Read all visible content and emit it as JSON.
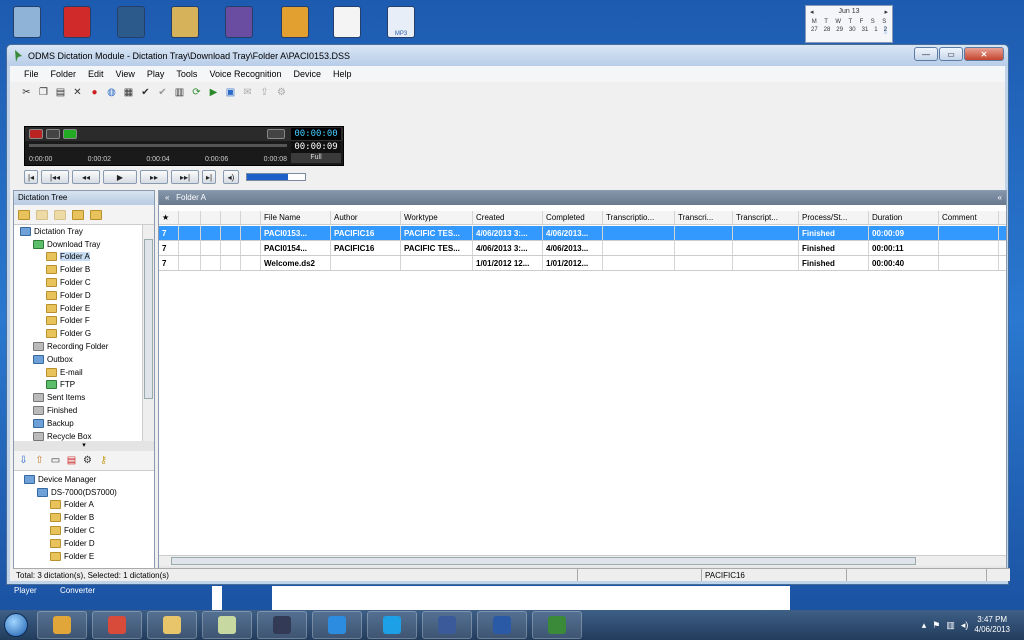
{
  "desktop": {
    "icons": [
      {
        "name": "recycle-bin-icon",
        "color": "#8fb3d6"
      },
      {
        "name": "red-app-icon",
        "color": "#d12a2a"
      },
      {
        "name": "transfer-app-icon",
        "color": "#2c5a8a"
      },
      {
        "name": "installer-box-icon",
        "color": "#d6b25a"
      },
      {
        "name": "pencil-app-icon",
        "color": "#6a4da0"
      },
      {
        "name": "house-icon",
        "color": "#e2a030"
      },
      {
        "name": "document-icon",
        "color": "#f4f4f4"
      },
      {
        "name": "mp3-file-icon",
        "color": "#e8eef8"
      }
    ],
    "mp3_label": "MP3",
    "labels": [
      "Player",
      "Converter"
    ],
    "calendar": {
      "month": "Jun 13",
      "days": [
        "M",
        "T",
        "W",
        "T",
        "F",
        "S",
        "S"
      ],
      "row1": [
        "27",
        "28",
        "29",
        "30",
        "31",
        "1",
        "2"
      ]
    }
  },
  "window": {
    "title": "ODMS Dictation Module - Dictation Tray\\Download Tray\\Folder A\\PACI0153.DSS",
    "menus": [
      "File",
      "Folder",
      "Edit",
      "View",
      "Play",
      "Tools",
      "Voice Recognition",
      "Device",
      "Help"
    ]
  },
  "player": {
    "time_current": "00:00:00",
    "time_total": "00:00:09",
    "mode": "Full",
    "progress_fraction": 0.0,
    "ticks": [
      "0:00:00",
      "0:00:02",
      "0:00:04",
      "0:00:06",
      "0:00:08"
    ],
    "volume_fraction": 0.7
  },
  "left_panel": {
    "title": "Dictation Tree",
    "tree": [
      {
        "label": "Dictation Tray",
        "indent": 0,
        "icon": "tray"
      },
      {
        "label": "Download Tray",
        "indent": 1,
        "icon": "green"
      },
      {
        "label": "Folder A",
        "indent": 2,
        "icon": "folder",
        "selected": true
      },
      {
        "label": "Folder B",
        "indent": 2,
        "icon": "folder"
      },
      {
        "label": "Folder C",
        "indent": 2,
        "icon": "folder"
      },
      {
        "label": "Folder D",
        "indent": 2,
        "icon": "folder"
      },
      {
        "label": "Folder E",
        "indent": 2,
        "icon": "folder"
      },
      {
        "label": "Folder F",
        "indent": 2,
        "icon": "folder"
      },
      {
        "label": "Folder G",
        "indent": 2,
        "icon": "folder"
      },
      {
        "label": "Recording Folder",
        "indent": 1,
        "icon": "gray"
      },
      {
        "label": "Outbox",
        "indent": 1,
        "icon": "tray"
      },
      {
        "label": "E-mail",
        "indent": 2,
        "icon": "folder"
      },
      {
        "label": "FTP",
        "indent": 2,
        "icon": "green"
      },
      {
        "label": "Sent Items",
        "indent": 1,
        "icon": "gray"
      },
      {
        "label": "Finished",
        "indent": 1,
        "icon": "gray"
      },
      {
        "label": "Backup",
        "indent": 1,
        "icon": "tray"
      },
      {
        "label": "Recycle Box",
        "indent": 1,
        "icon": "gray"
      }
    ],
    "device_tree": [
      {
        "label": "Device Manager",
        "indent": 0,
        "icon": "tray"
      },
      {
        "label": "DS-7000(DS7000)",
        "indent": 1,
        "icon": "tray"
      },
      {
        "label": "Folder A",
        "indent": 2,
        "icon": "folder"
      },
      {
        "label": "Folder B",
        "indent": 2,
        "icon": "folder"
      },
      {
        "label": "Folder C",
        "indent": 2,
        "icon": "folder"
      },
      {
        "label": "Folder D",
        "indent": 2,
        "icon": "folder"
      },
      {
        "label": "Folder E",
        "indent": 2,
        "icon": "folder"
      }
    ]
  },
  "right_panel": {
    "title": "Folder A",
    "columns": [
      "★",
      "",
      "",
      "",
      "",
      "File Name",
      "Author",
      "Worktype",
      "Created",
      "Completed",
      "Transcriptio...",
      "Transcri...",
      "Transcript...",
      "Process/St...",
      "Duration",
      "Comment"
    ],
    "rows": [
      {
        "priority": "7",
        "file": "PACI0153...",
        "author": "PACIFIC16",
        "worktype": "PACIFIC TES...",
        "created": "4/06/2013 3:...",
        "completed": "4/06/2013...",
        "status": "Finished",
        "duration": "00:00:09",
        "selected": true
      },
      {
        "priority": "7",
        "file": "PACI0154...",
        "author": "PACIFIC16",
        "worktype": "PACIFIC TES...",
        "created": "4/06/2013 3:...",
        "completed": "4/06/2013...",
        "status": "Finished",
        "duration": "00:00:11",
        "selected": false
      },
      {
        "priority": "7",
        "file": "Welcome.ds2",
        "author": "",
        "worktype": "",
        "created": "1/01/2012 12...",
        "completed": "1/01/2012...",
        "status": "Finished",
        "duration": "00:00:40",
        "selected": false
      }
    ]
  },
  "status": {
    "summary": "Total: 3 dictation(s), Selected: 1 dictation(s)",
    "author": "PACIFIC16"
  },
  "taskbar": {
    "apps": [
      {
        "name": "outlook-icon",
        "color": "#e0a63a"
      },
      {
        "name": "chrome-icon",
        "color": "#d84a3a"
      },
      {
        "name": "explorer-icon",
        "color": "#e8c56a"
      },
      {
        "name": "folder-app-icon",
        "color": "#c7d9a0"
      },
      {
        "name": "pen-app-icon",
        "color": "#333a55"
      },
      {
        "name": "ie-icon",
        "color": "#2c8de0"
      },
      {
        "name": "skype-icon",
        "color": "#1ea0e6"
      },
      {
        "name": "transfer-icon",
        "color": "#3a5a9a"
      },
      {
        "name": "word-icon",
        "color": "#2a5aa6"
      },
      {
        "name": "odms-icon",
        "color": "#3a8a3a"
      }
    ],
    "time": "3:47 PM",
    "date": "4/06/2013"
  }
}
